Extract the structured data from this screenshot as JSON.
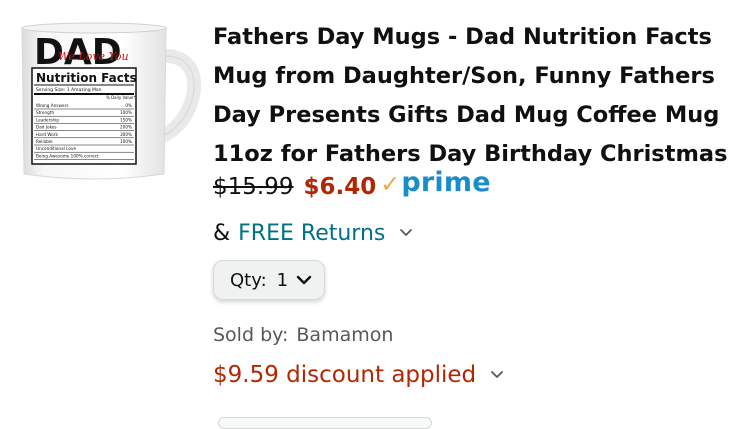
{
  "product": {
    "image": {
      "alt": "DAD Nutrition Facts mug",
      "mug_big_text": "DAD",
      "mug_script_text": "We Love You",
      "mug_panel_title": "Nutrition Facts",
      "mug_serving": "Serving Size: 1 Amazing Man",
      "mug_daily": "% Daily Value*",
      "mug_rows": [
        {
          "name": "Wrong Answers",
          "value": "0%"
        },
        {
          "name": "Strength",
          "value": "100%"
        },
        {
          "name": "Leadership",
          "value": "150%"
        },
        {
          "name": "Dad Jokes",
          "value": "200%"
        },
        {
          "name": "Hard Work",
          "value": "300%"
        },
        {
          "name": "Reliable",
          "value": "100%"
        },
        {
          "name": "Unconditional Love",
          "value": ""
        },
        {
          "name": "Being Awesome 100% correct",
          "value": ""
        }
      ]
    },
    "title": "Fathers Day Mugs - Dad Nutrition Facts Mug from Daughter/Son, Funny Fathers Day Presents Gifts Dad Mug Coffee Mug 11oz for Fathers Day Birthday Christmas",
    "list_price": "$15.99",
    "sale_price": "$6.40",
    "prime_check": "✓",
    "prime_label": "prime",
    "returns_prefix": "&",
    "returns_label": "FREE Returns",
    "qty_label": "Qty:",
    "qty_value": "1",
    "sold_by_label": "Sold by:",
    "seller": "Bamamon",
    "discount_text": "$9.59 discount applied"
  },
  "icons": {
    "returns_chevron": "chevron-down-icon",
    "qty_chevron": "chevron-down-icon",
    "discount_chevron": "chevron-down-icon",
    "prime_check": "checkmark-icon"
  },
  "colors": {
    "sale_price": "#b12704",
    "discount": "#b12704",
    "link": "#007185",
    "prime_blue": "#1a8cc9",
    "prime_check": "#f3a847",
    "sold_by": "#565959"
  }
}
